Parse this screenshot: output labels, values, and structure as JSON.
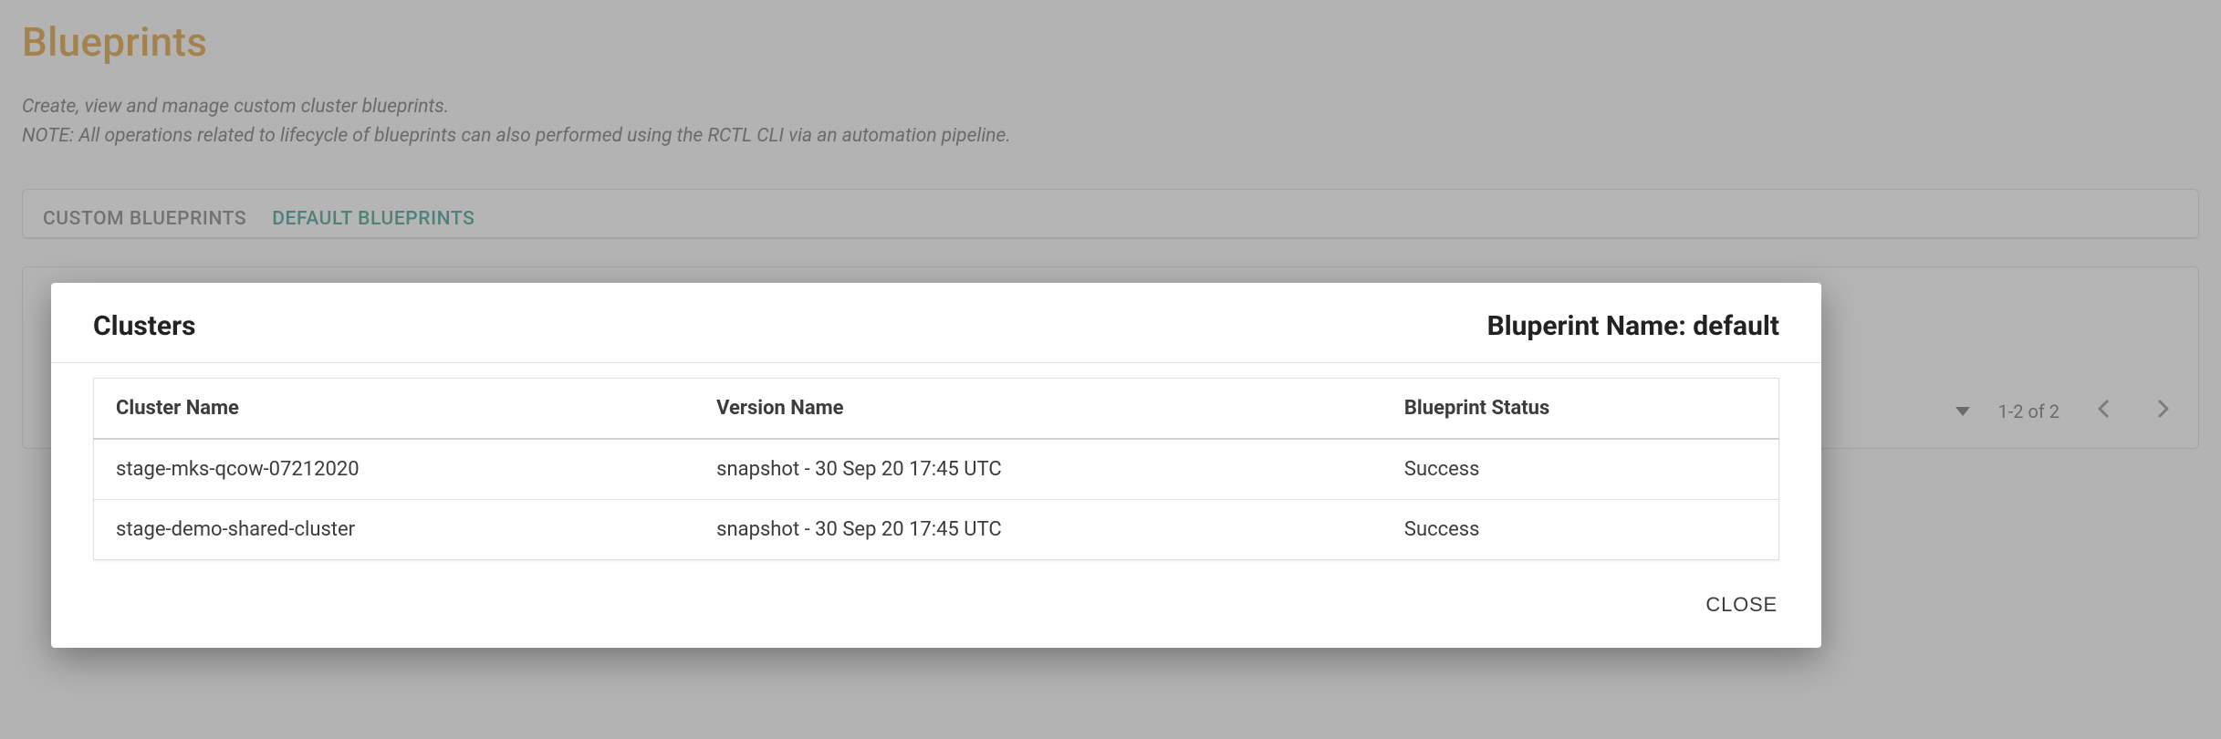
{
  "page": {
    "title": "Blueprints",
    "desc_line1": "Create, view and manage custom cluster blueprints.",
    "desc_line2": "NOTE: All operations related to lifecycle of blueprints can also performed using the RCTL CLI via an automation pipeline."
  },
  "tabs": {
    "custom": "CUSTOM BLUEPRINTS",
    "default": "DEFAULT BLUEPRINTS"
  },
  "footer": {
    "range": "1-2 of 2"
  },
  "dialog": {
    "title_left": "Clusters",
    "title_right": "Bluperint Name: default",
    "close_label": "CLOSE",
    "columns": {
      "cluster_name": "Cluster Name",
      "version_name": "Version Name",
      "blueprint_status": "Blueprint Status"
    },
    "rows": [
      {
        "cluster_name": "stage-mks-qcow-07212020",
        "version_name": "snapshot - 30 Sep 20 17:45 UTC",
        "blueprint_status": "Success"
      },
      {
        "cluster_name": "stage-demo-shared-cluster",
        "version_name": "snapshot - 30 Sep 20 17:45 UTC",
        "blueprint_status": "Success"
      }
    ]
  }
}
